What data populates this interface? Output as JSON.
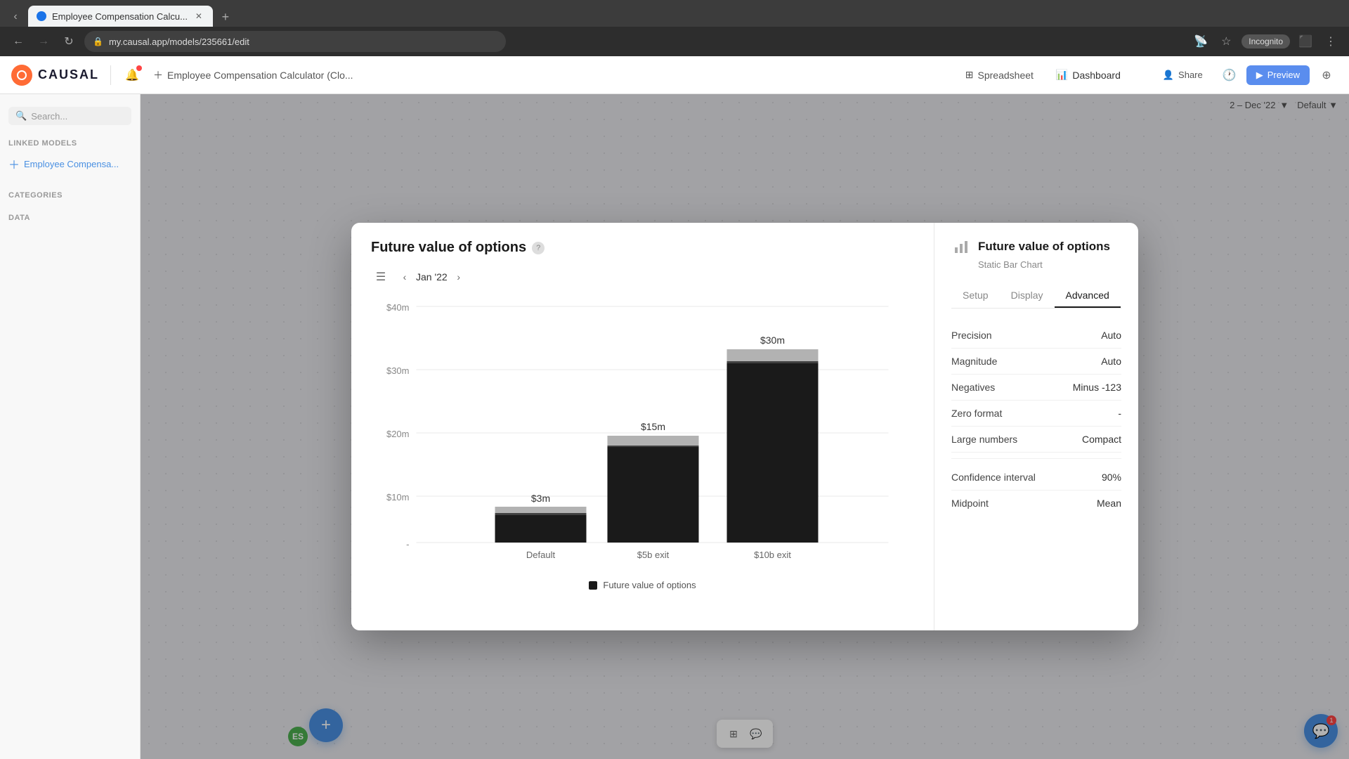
{
  "browser": {
    "tab_title": "Employee Compensation Calcu...",
    "tab_favicon": "●",
    "url": "my.causal.app/models/235661/edit",
    "incognito_label": "Incognito",
    "new_tab_label": "+"
  },
  "app": {
    "logo_text": "CAUSAL",
    "model_name": "Employee Compensation Calculator (Clo...",
    "nav_items": [
      {
        "id": "spreadsheet",
        "label": "Spreadsheet",
        "icon": "⊞"
      },
      {
        "id": "dashboard",
        "label": "Dashboard",
        "icon": "📊"
      }
    ],
    "header_actions": {
      "share_label": "Share",
      "preview_label": "Preview"
    }
  },
  "sidebar": {
    "search_placeholder": "Search...",
    "linked_models_label": "Linked models",
    "linked_model_item": "Employee Compensa...",
    "categories_label": "Categories",
    "data_label": "Data"
  },
  "canvas": {
    "date_range": "2 – Dec '22",
    "default_label": "Default"
  },
  "modal": {
    "chart_title": "Future value of options",
    "chart_date": "Jan '22",
    "y_axis_labels": [
      "$40m",
      "$30m",
      "$20m",
      "$10m",
      "-"
    ],
    "bars": [
      {
        "label": "Default",
        "value_label": "$3m",
        "value": 3,
        "max": 40
      },
      {
        "label": "$5b exit",
        "value_label": "$15m",
        "value": 15,
        "max": 40
      },
      {
        "label": "$10b exit",
        "value_label": "$30m",
        "value": 30,
        "max": 40
      }
    ],
    "legend_label": "Future value of options",
    "settings": {
      "title": "Future value of options",
      "subtitle": "Static Bar Chart",
      "tabs": [
        "Setup",
        "Display",
        "Advanced"
      ],
      "active_tab": "Advanced",
      "rows": [
        {
          "label": "Precision",
          "value": "Auto"
        },
        {
          "label": "Magnitude",
          "value": "Auto"
        },
        {
          "label": "Negatives",
          "value": "Minus -123"
        },
        {
          "label": "Zero format",
          "value": "-"
        },
        {
          "label": "Large numbers",
          "value": "Compact"
        },
        {
          "label": "Confidence interval",
          "value": "90%"
        },
        {
          "label": "Midpoint",
          "value": "Mean"
        }
      ]
    }
  },
  "fab": {
    "label": "+"
  },
  "chat_fab": {
    "badge": "1"
  },
  "user": {
    "initials": "ES"
  }
}
